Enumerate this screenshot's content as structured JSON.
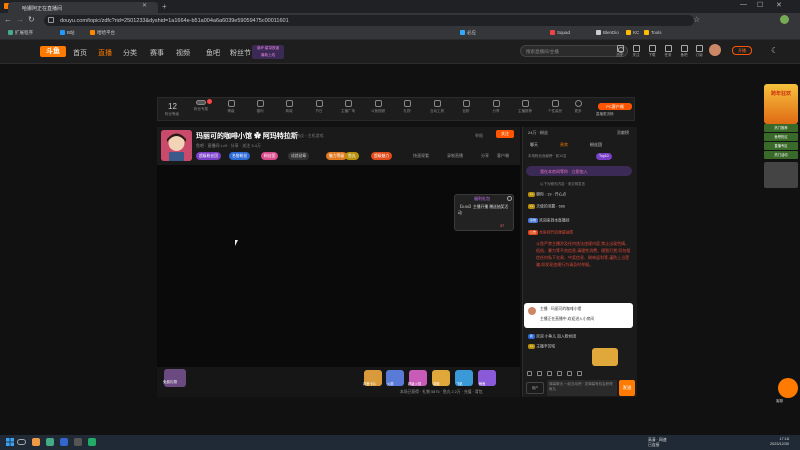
{
  "browser": {
    "tab_title": "哈娜阿正在直播间",
    "url": "douyu.com/topic/zdfc?rid=2501233&dyshid=1a1664e-b51a004a6a6039e59059475c00011601",
    "bookmarks": [
      "扩展程序",
      "B站",
      "哈哈平台",
      "必应",
      "Squad",
      "BlenDio",
      "KC",
      "Tools"
    ]
  },
  "site_header": {
    "logo": "斗鱼",
    "nav": [
      "首页",
      "直播",
      "分类",
      "赛事",
      "视频",
      "鱼吧",
      "粉丝节"
    ],
    "promo": [
      "崩坏:星穹铁道",
      "最新上线"
    ],
    "search_placeholder": "搜索直播间/主播",
    "icons": [
      {
        "name": "history-icon",
        "label": "历史"
      },
      {
        "name": "follow-icon",
        "label": "关注"
      },
      {
        "name": "download-icon",
        "label": "下载"
      },
      {
        "name": "task-icon",
        "label": "任务"
      },
      {
        "name": "fish-icon",
        "label": "鱼吧"
      },
      {
        "name": "message-icon",
        "label": "订阅"
      }
    ],
    "open_live": "开播"
  },
  "toolbar": {
    "level": "12",
    "level_label": "粉丝等级",
    "items": [
      "粉丝专属",
      "等级",
      "福利",
      "商城",
      "节日",
      "主播广场",
      "斗鱼视频",
      "礼物",
      "互动工具",
      "钻粉",
      "分享",
      "主播推荐",
      "个性装扮",
      "更多"
    ],
    "pc_client": "PC客户端",
    "pc_sub": "直播更流畅"
  },
  "room": {
    "title": "玛丽可的咖啡小馆 ✿ 阿玛特拉斯",
    "category": "聊天热议 › 主机游戏",
    "report": "举报",
    "follow": "关注",
    "meta": "鱼吧 · 直播间 Lv9 · 分享 · 关注 3.4万",
    "badges": [
      "超级粉丝团",
      "名誉粉丝",
      "粉丝团",
      "成就勋章",
      "魅力等级",
      "鱼丸",
      "超级魅力"
    ],
    "links": [
      "快速观看",
      "录制直播",
      "分享",
      "客户端"
    ]
  },
  "video_popup": {
    "tag": "福利礼包",
    "text": "【0:00】主播开播 赠送抽奖活动",
    "count": "37"
  },
  "gifts": {
    "left_label": "免费礼物",
    "items": [
      "真爱卡片",
      "火箭",
      "超级火箭",
      "游艇",
      "飞机",
      "鲸鱼"
    ],
    "footer": "本场已获得 · 礼物 5875 · 鱼丸 2.2万 · 充值 · 背包"
  },
  "chat": {
    "top_left": "24万 · 粉丝",
    "top_right": "贡献榜",
    "tabs": [
      "聊天",
      "贵宾",
      "粉丝团"
    ],
    "rank_text": "本场粉丝贡献榜 · 前10名",
    "fan_banner": "我在本房间等你 · 立即加入",
    "hint": "以下为聊天内容 · 请文明发言",
    "rows": [
      {
        "badge": "Lv",
        "text": "聊你 · 19 · 开心点"
      },
      {
        "badge": "Lv",
        "text": "天使的羽翼 · 666"
      },
      {
        "badge": "系统",
        "text": "欢迎来到本直播间"
      },
      {
        "badge": "公告",
        "text": "本房间开启弹幕抽奖"
      }
    ],
    "system_message": "斗鱼严禁主播涉及任何违法违规内容,禁止出现色情、低俗、暴力等不良信息,请理性消费、理智打赏,切勿相信任何私下交易、中奖信息、刷单返利等,谨防上当受骗,如发现违规行为请及时举报。",
    "notice_name": "主播 · 玛丽可的咖啡小馆",
    "notice_text": "主播正在直播中,欢迎进入小房间",
    "bottom_rows": [
      {
        "badge": "新",
        "text": "欢迎 小鱼儿 加入粉丝团"
      },
      {
        "badge": "Lv",
        "text": "主播辛苦啦"
      }
    ],
    "user_label": "用户",
    "input_placeholder": "弹幕聊天,一起互动吧 · 发弹幕有机会获得鱼丸",
    "send": "发送"
  },
  "sidebar_ad": {
    "title": "跨年狂欢",
    "links": [
      "热门推荐",
      "鱼吧热议",
      "直播专区",
      "热门活动",
      "更多精彩"
    ]
  },
  "float_button_label": "客服",
  "taskbar": {
    "tray": [
      "高清 · 网速",
      "已连接"
    ],
    "time": "17:18",
    "date": "2023/12/30"
  }
}
